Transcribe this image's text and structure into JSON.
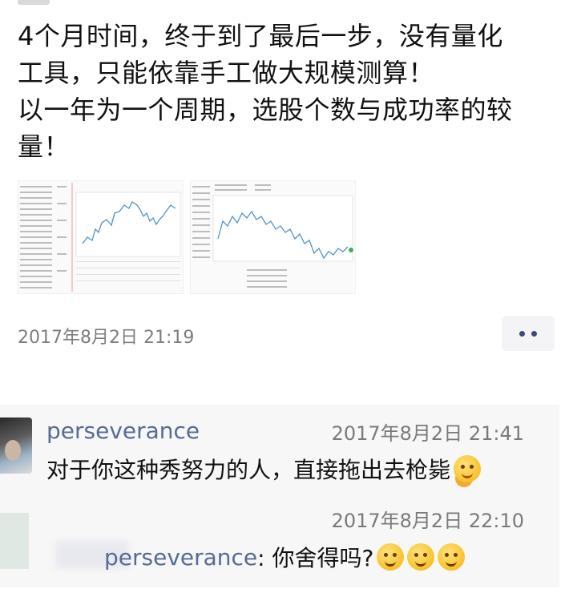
{
  "post": {
    "lines": [
      "4个月时间，终于到了最后一步，没有量化",
      "工具，只能依靠手工做大规模测算！",
      "以一年为一个周期，选股个数与成功率的较",
      "量！"
    ],
    "timestamp": "2017年8月2日 21:19",
    "images": [
      "spreadsheet-chart-image",
      "spreadsheet-chart-image"
    ]
  },
  "more_button": {
    "icon": "more-dots-icon"
  },
  "comments": [
    {
      "author": "perseverance",
      "time": "2017年8月2日 21:41",
      "text": "对于你这种秀努力的人，直接拖出去枪毙",
      "emoji": [
        "hug-emoji-icon"
      ]
    },
    {
      "time": "2017年8月2日 22:10",
      "reply_to": "perseverance",
      "text": ": 你舍得吗?",
      "emoji": [
        "smile-emoji-icon",
        "smile-emoji-icon",
        "smile-emoji-icon"
      ]
    }
  ],
  "colors": {
    "link": "#566b95",
    "meta": "#7a7a7a",
    "comment_bg": "#f7f7f7"
  }
}
